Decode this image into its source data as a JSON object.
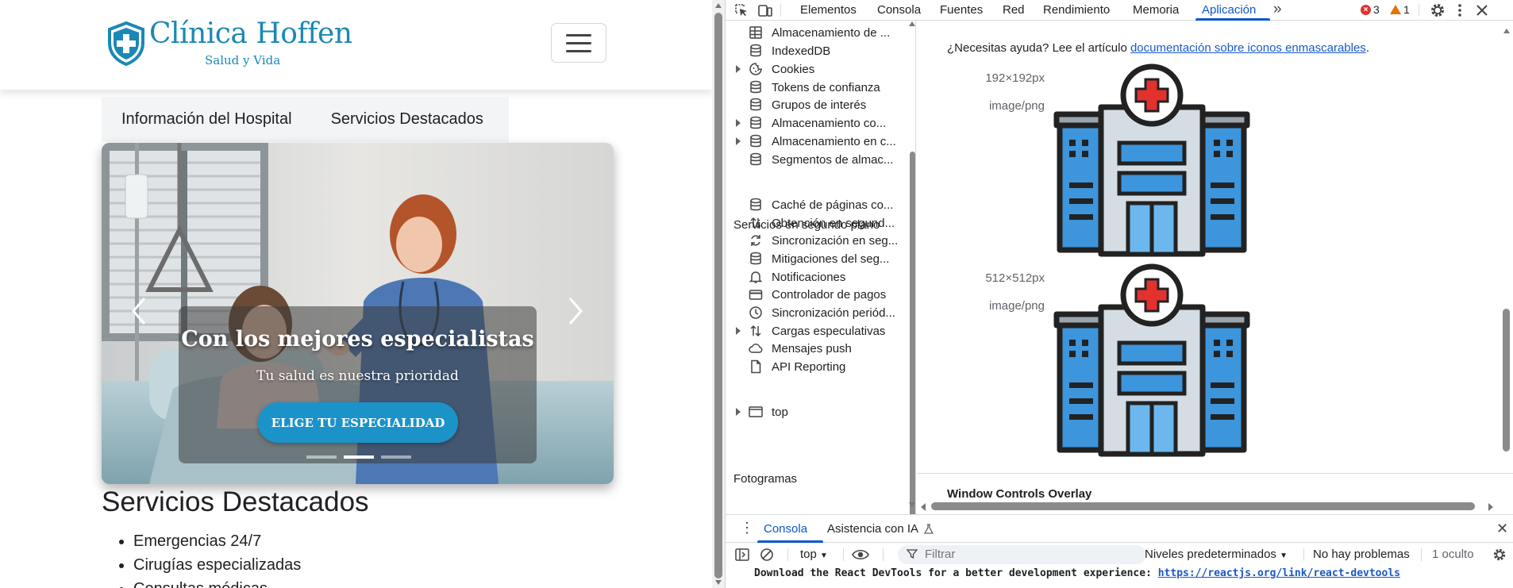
{
  "site": {
    "brand_name": "Clínica Hoffen",
    "brand_tagline": "Salud y Vida",
    "tabs": [
      "Información del Hospital",
      "Servicios Destacados"
    ],
    "carousel": {
      "title": "Con los mejores especialistas",
      "subtitle": "Tu salud es nuestra prioridad",
      "button": "ELIGE TU ESPECIALIDAD",
      "slide_count": 3,
      "active_slide": 2
    },
    "services_title": "Servicios Destacados",
    "services": [
      "Emergencias 24/7",
      "Cirugías especializadas",
      "Consultas médicas"
    ]
  },
  "devtools": {
    "tabs": [
      "Elementos",
      "Consola",
      "Fuentes",
      "Red",
      "Rendimiento",
      "Memoria",
      "Aplicación"
    ],
    "active_tab": "Aplicación",
    "error_count": "3",
    "warning_count": "1",
    "sidebar": {
      "items": [
        {
          "label": "Almacenamiento de ...",
          "icon": "table-icon",
          "expandable": false
        },
        {
          "label": "IndexedDB",
          "icon": "database-icon",
          "expandable": false
        },
        {
          "label": "Cookies",
          "icon": "cookie-icon",
          "expandable": true
        },
        {
          "label": "Tokens de confianza",
          "icon": "database-icon",
          "expandable": false
        },
        {
          "label": "Grupos de interés",
          "icon": "database-icon",
          "expandable": false
        },
        {
          "label": "Almacenamiento co...",
          "icon": "database-icon",
          "expandable": true
        },
        {
          "label": "Almacenamiento en c...",
          "icon": "database-icon",
          "expandable": true
        },
        {
          "label": "Segmentos de almac...",
          "icon": "database-icon",
          "expandable": false
        }
      ],
      "section_background": "Servicios en segundo plano",
      "background_items": [
        {
          "label": "Caché de páginas co...",
          "icon": "database-icon",
          "expandable": false
        },
        {
          "label": "Obtención en segund...",
          "icon": "arrows-updown-icon",
          "expandable": false
        },
        {
          "label": "Sincronización en seg...",
          "icon": "sync-icon",
          "expandable": false
        },
        {
          "label": "Mitigaciones del seg...",
          "icon": "database-icon",
          "expandable": false
        },
        {
          "label": "Notificaciones",
          "icon": "bell-icon",
          "expandable": false
        },
        {
          "label": "Controlador de pagos",
          "icon": "card-icon",
          "expandable": false
        },
        {
          "label": "Sincronización periód...",
          "icon": "clock-icon",
          "expandable": false
        },
        {
          "label": "Cargas especulativas",
          "icon": "arrows-updown-icon",
          "expandable": true
        },
        {
          "label": "Mensajes push",
          "icon": "cloud-icon",
          "expandable": false
        },
        {
          "label": "API Reporting",
          "icon": "file-icon",
          "expandable": false
        }
      ],
      "section_frames": "Fotogramas",
      "frames": [
        {
          "label": "top",
          "icon": "frame-icon",
          "expandable": true
        }
      ]
    },
    "manifest": {
      "help_text": "¿Necesitas ayuda? Lee el artículo ",
      "help_link": "documentación sobre iconos enmascarables",
      "help_end": ".",
      "icons": [
        {
          "size": "192×192px",
          "type": "image/png"
        },
        {
          "size": "512×512px",
          "type": "image/png"
        }
      ],
      "next_section": "Window Controls Overlay"
    },
    "drawer": {
      "tabs": [
        "Consola",
        "Asistencia con IA"
      ],
      "active_tab": "Consola",
      "context": "top",
      "filter_placeholder": "Filtrar",
      "levels": "Niveles predeterminados",
      "issues": "No hay problemas",
      "hidden": "1 oculto",
      "message_text": "Download the React DevTools for a better development experience: ",
      "message_link": "https://reactjs.org/link/react-devtools"
    }
  },
  "colors": {
    "brand": "#1b88b5",
    "button": "#1b93c9",
    "devtools_accent": "#0b57d0",
    "link": "#1a59c7"
  }
}
